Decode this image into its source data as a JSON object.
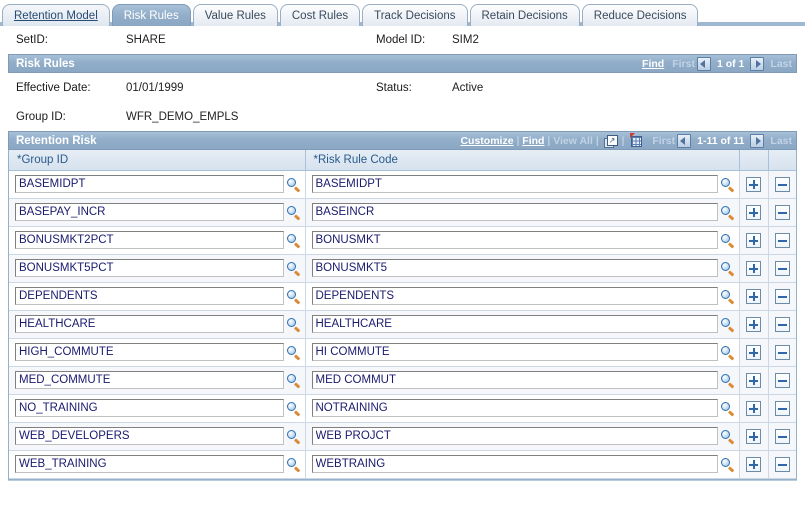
{
  "tabs": [
    {
      "label": "Retention Model",
      "state": "link"
    },
    {
      "label": "Risk Rules",
      "state": "active"
    },
    {
      "label": "Value Rules",
      "state": "inactive"
    },
    {
      "label": "Cost Rules",
      "state": "inactive"
    },
    {
      "label": "Track Decisions",
      "state": "inactive"
    },
    {
      "label": "Retain Decisions",
      "state": "inactive"
    },
    {
      "label": "Reduce Decisions",
      "state": "inactive"
    }
  ],
  "header_fields": {
    "setid_label": "SetID:",
    "setid_value": "SHARE",
    "model_id_label": "Model ID:",
    "model_id_value": "SIM2"
  },
  "risk_rules_section": {
    "title": "Risk Rules",
    "find_label": "Find",
    "first_label": "First",
    "last_label": "Last",
    "page_indicator": "1 of 1"
  },
  "detail_fields": {
    "effective_date_label": "Effective Date:",
    "effective_date_value": "01/01/1999",
    "status_label": "Status:",
    "status_value": "Active",
    "group_id_label": "Group ID:",
    "group_id_value": "WFR_DEMO_EMPLS"
  },
  "retention_risk_section": {
    "title": "Retention Risk",
    "customize_label": "Customize",
    "find_label": "Find",
    "view_all_label": "View All",
    "new_window_icon": "new-window-icon",
    "spreadsheet_icon": "download-spreadsheet-icon",
    "first_label": "First",
    "last_label": "Last",
    "page_indicator": "1-11 of 11"
  },
  "grid": {
    "columns": [
      {
        "label": "*Group ID"
      },
      {
        "label": "*Risk Rule Code"
      }
    ],
    "add_button_label": "+",
    "delete_button_label": "-",
    "lookup_icon": "lookup-magnifier-icon",
    "rows": [
      {
        "group_id": "BASEMIDPT",
        "risk_rule_code": "BASEMIDPT"
      },
      {
        "group_id": "BASEPAY_INCR",
        "risk_rule_code": "BASEINCR"
      },
      {
        "group_id": "BONUSMKT2PCT",
        "risk_rule_code": "BONUSMKT"
      },
      {
        "group_id": "BONUSMKT5PCT",
        "risk_rule_code": "BONUSMKT5"
      },
      {
        "group_id": "DEPENDENTS",
        "risk_rule_code": "DEPENDENTS"
      },
      {
        "group_id": "HEALTHCARE",
        "risk_rule_code": "HEALTHCARE"
      },
      {
        "group_id": "HIGH_COMMUTE",
        "risk_rule_code": "HI COMMUTE"
      },
      {
        "group_id": "MED_COMMUTE",
        "risk_rule_code": "MED COMMUT"
      },
      {
        "group_id": "NO_TRAINING",
        "risk_rule_code": "NOTRAINING"
      },
      {
        "group_id": "WEB_DEVELOPERS",
        "risk_rule_code": "WEB PROJCT"
      },
      {
        "group_id": "WEB_TRAINING",
        "risk_rule_code": "WEBTRAING"
      }
    ]
  },
  "colors": {
    "tab_active_bg": "#8aa7c4",
    "section_bar_bg": "#8aa7c4",
    "column_header_bg": "#d6e2ee",
    "column_header_text": "#2a5b8c",
    "input_text": "#1a1a6e",
    "row_button_glyph": "#2f68a8"
  }
}
